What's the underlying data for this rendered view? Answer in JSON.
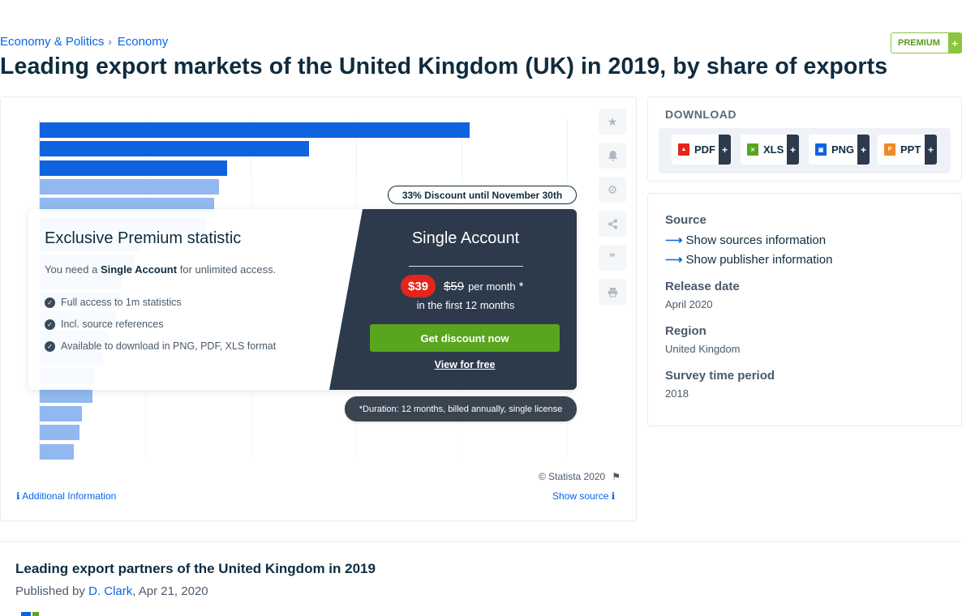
{
  "breadcrumb": {
    "items": [
      "Economy & Politics",
      "Economy"
    ],
    "separator": "›"
  },
  "premium_badge": {
    "label": "PREMIUM",
    "plus": "+"
  },
  "page_title": "Leading export markets of the United Kingdom (UK) in 2019, by share of exports",
  "chart": {
    "bars": [
      16.3,
      10.2,
      7.1,
      6.8,
      6.6,
      6.3,
      3.8,
      3.6,
      3.1,
      3.0,
      2.9,
      2.6,
      2.4,
      2.1,
      2.0,
      1.6,
      1.5,
      1.3
    ],
    "bar_scale_max": 20
  },
  "discount": {
    "text": "33% Discount until November 30th"
  },
  "paywall": {
    "title": "Exclusive Premium statistic",
    "need_prefix": "You need a ",
    "need_bold": "Single Account",
    "need_suffix": " for unlimited access.",
    "features": [
      "Full access to 1m statistics",
      "Incl. source references",
      "Available to download in PNG, PDF, XLS format"
    ],
    "account_title": "Single Account",
    "price_new": "$39",
    "price_old": "$59",
    "per_month": "per month",
    "asterisk": "*",
    "first_months": "in the first 12 months",
    "cta": "Get discount now",
    "view_free": "View for free",
    "duration": "*Duration: 12 months, billed annually, single license"
  },
  "footer": {
    "copyright": "© Statista 2020",
    "additional_info": "Additional Information",
    "show_source": "Show source"
  },
  "tools": [
    "star-icon",
    "bell-icon",
    "gear-icon",
    "share-icon",
    "quote-icon",
    "print-icon"
  ],
  "download": {
    "title": "DOWNLOAD",
    "buttons": [
      {
        "label": "PDF",
        "icon": "pdf-file-icon",
        "color": "#e3251b"
      },
      {
        "label": "XLS",
        "icon": "xls-file-icon",
        "color": "#5aa51f"
      },
      {
        "label": "PNG",
        "icon": "png-file-icon",
        "color": "#0f63df"
      },
      {
        "label": "PPT",
        "icon": "ppt-file-icon",
        "color": "#f08a24"
      }
    ],
    "plus": "+"
  },
  "info": {
    "source_label": "Source",
    "show_sources": "Show sources information",
    "show_publisher": "Show publisher information",
    "release_label": "Release date",
    "release_value": "April 2020",
    "region_label": "Region",
    "region_value": "United Kingdom",
    "survey_label": "Survey time period",
    "survey_value": "2018"
  },
  "related": {
    "title": "Leading export partners of the United Kingdom in 2019",
    "published_prefix": "Published by ",
    "author": "D. Clark",
    "date_suffix": ", Apr 21, 2020"
  },
  "colors": {
    "accent": "#0666e5",
    "bar": "#0f63df",
    "cta": "#5aa51f",
    "price": "#e3251b",
    "dark": "#2c3a4c"
  }
}
